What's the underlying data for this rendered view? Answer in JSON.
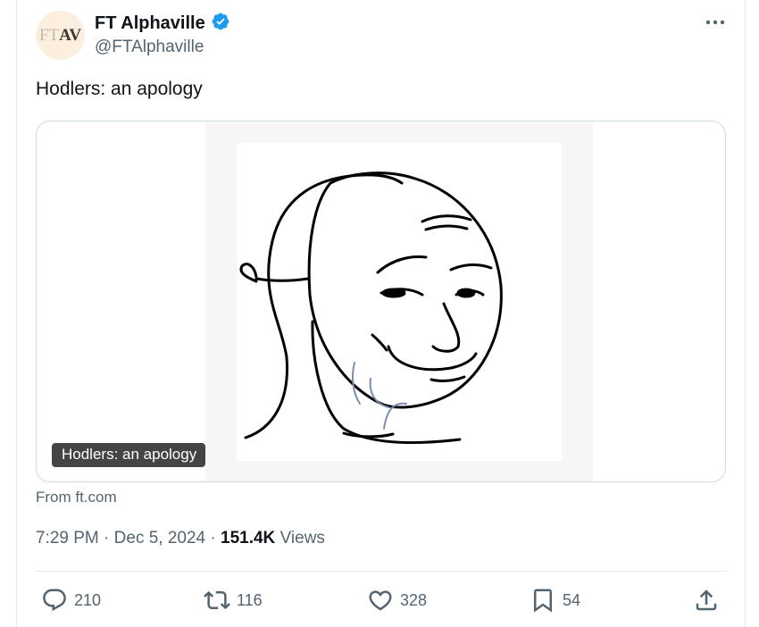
{
  "tweet": {
    "avatar_ft": "FT",
    "avatar_av": "AV",
    "name": "FT Alphaville",
    "handle": "@FTAlphaville",
    "text": "Hodlers: an apology",
    "media_caption": "Hodlers: an apology",
    "from": "From ft.com",
    "time": "7:29 PM",
    "date": "Dec 5, 2024",
    "views_count": "151.4K",
    "views_label": "Views",
    "sep": "·"
  },
  "actions": {
    "replies": "210",
    "reposts": "116",
    "likes": "328",
    "bookmarks": "54"
  },
  "icons": {
    "verified": "verified-badge-icon",
    "more": "more-icon",
    "reply": "reply-icon",
    "repost": "repost-icon",
    "like": "like-icon",
    "bookmark": "bookmark-icon",
    "share": "share-icon"
  },
  "colors": {
    "verified_blue": "#1d9bf0",
    "text_primary": "#0f1419",
    "text_secondary": "#536471",
    "avatar_bg": "#fcefe0"
  }
}
